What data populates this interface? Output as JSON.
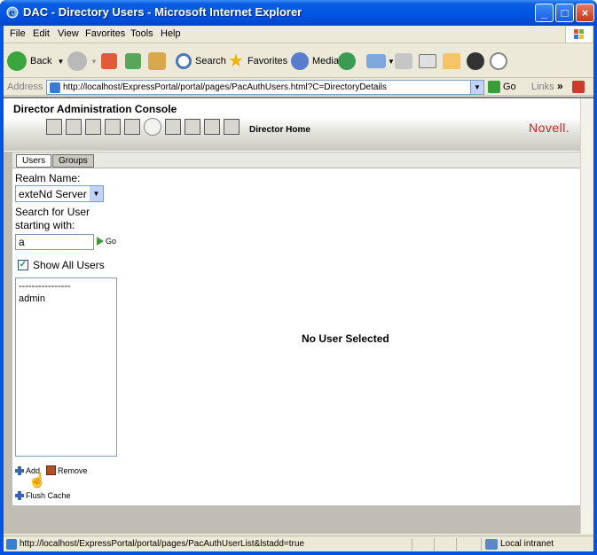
{
  "window": {
    "title": "DAC - Directory Users - Microsoft Internet Explorer",
    "controls": {
      "minimize": "_",
      "maximize": "□",
      "close": "×"
    }
  },
  "menu": [
    "File",
    "Edit",
    "View",
    "Favorites",
    "Tools",
    "Help"
  ],
  "toolbar": {
    "back": "Back",
    "search": "Search",
    "favorites": "Favorites",
    "media": "Media"
  },
  "address": {
    "label": "Address",
    "url": "http://localhost/ExpressPortal/portal/pages/PacAuthUsers.html?C=DirectoryDetails",
    "go": "Go",
    "links": "Links"
  },
  "dac": {
    "title": "Director Administration Console",
    "home_label": "Director Home",
    "brand": "Novell."
  },
  "tabs": {
    "users": "Users",
    "groups": "Groups"
  },
  "form": {
    "realm_label": "Realm Name:",
    "realm_value": "exteNd Server",
    "search_label_1": "Search for User",
    "search_label_2": "starting with:",
    "search_value": "a",
    "go_label": "Go",
    "show_all_label": "Show All Users",
    "show_all_checked": "✓"
  },
  "userlist": {
    "options": [
      "----------------",
      "admin"
    ]
  },
  "actions": {
    "add": "Add",
    "remove": "Remove",
    "flush": "Flush Cache"
  },
  "detail": {
    "empty": "No User Selected"
  },
  "status": {
    "url": "http://localhost/ExpressPortal/portal/pages/PacAuthUserList&lstadd=true",
    "zone": "Local intranet"
  },
  "colors": {
    "titlebar": "#0054e3",
    "chrome": "#ece9d8",
    "brand": "#cc2222"
  }
}
